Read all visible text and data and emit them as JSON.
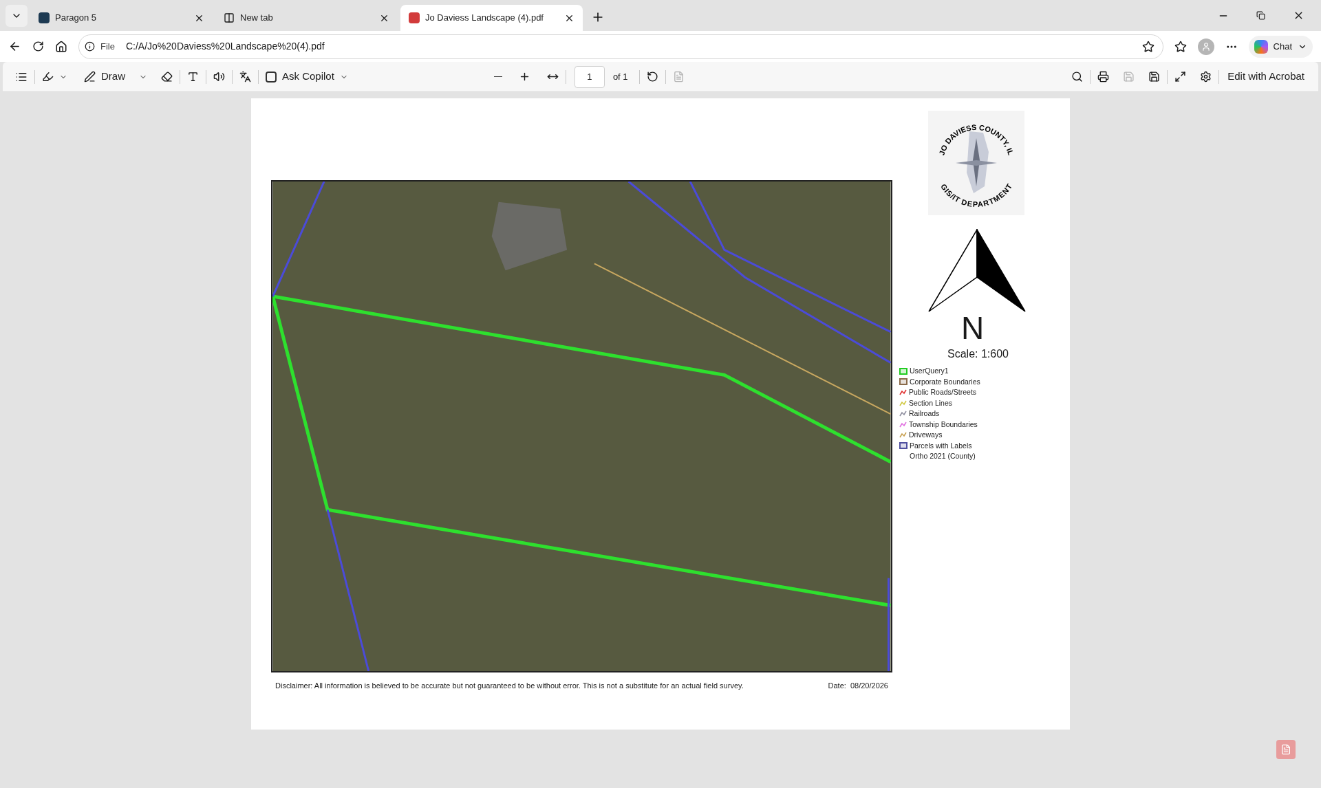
{
  "tabs": [
    {
      "title": "Paragon 5",
      "kind": "site",
      "selected": false
    },
    {
      "title": "New tab",
      "kind": "newtab",
      "selected": false
    },
    {
      "title": "Jo Daviess Landscape (4).pdf",
      "kind": "pdf",
      "selected": true
    }
  ],
  "address": {
    "scheme": "File",
    "url": "C:/A/Jo%20Daviess%20Landscape%20(4).pdf"
  },
  "chat": {
    "label": "Chat"
  },
  "toolbar": {
    "draw": "Draw",
    "copilot": "Ask Copilot",
    "page": "1",
    "page_count": "of 1",
    "edit": "Edit with Acrobat"
  },
  "document": {
    "logo": {
      "top_text": "JO DAVIESS COUNTY, IL",
      "bottom_text": "GIS/IT DEPARTMENT"
    },
    "north": "N",
    "scale": "Scale: 1:600",
    "legend": [
      {
        "label": "UserQuery1",
        "kind": "box",
        "color": "#22cc22"
      },
      {
        "label": "Corporate Boundaries",
        "kind": "box",
        "color": "#8b6b4a"
      },
      {
        "label": "Public Roads/Streets",
        "kind": "line",
        "color": "#e03030"
      },
      {
        "label": "Section Lines",
        "kind": "line",
        "color": "#d0c840"
      },
      {
        "label": "Railroads",
        "kind": "line",
        "color": "#9090a0"
      },
      {
        "label": "Township Boundaries",
        "kind": "line",
        "color": "#e070e0"
      },
      {
        "label": "Driveways",
        "kind": "line",
        "color": "#c8a050"
      },
      {
        "label": "Parcels with Labels",
        "kind": "box",
        "color": "#5050a0"
      },
      {
        "label": "Ortho 2021 (County)",
        "kind": "none"
      }
    ],
    "disclaimer": "Disclaimer: All information is believed to be accurate but not guaranteed to be without error. This is not a substitute for an actual field survey.",
    "date": "Date:  08/20/2026"
  }
}
